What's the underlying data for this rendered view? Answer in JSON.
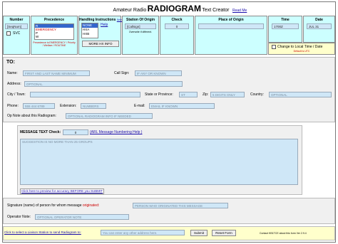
{
  "header": {
    "title_pre": "Amateur Radio",
    "title_main": "RADIOGRAM",
    "title_post": "Text Creator",
    "read_me": "Read Me"
  },
  "columns": {
    "number": {
      "label": "Number",
      "value": "[SeqNum]",
      "svc": "SVC"
    },
    "precedence": {
      "label": "Precedence",
      "options": [
        "R",
        "EMERGENCY",
        "P",
        "W"
      ],
      "note": "Precedence is EMERGENCY / Priority / Welfare / ROUTINE"
    },
    "handling": {
      "label": "Handling Instructions",
      "select_link": "Select",
      "help_link": "Help",
      "options": [
        "NONE",
        "HXA",
        "HXB"
      ],
      "more": "MORE HX INFO"
    },
    "station_origin": {
      "label": "Station Of Origin",
      "value": "[Callsign]",
      "note": "Overwrite if different."
    },
    "check": {
      "label": "Check",
      "value": "0"
    },
    "place_origin": {
      "label": "Place of Origin",
      "value": ""
    },
    "time": {
      "label": "Time",
      "value": "1700Z"
    },
    "date": {
      "label": "Date",
      "value": "JUL 31"
    },
    "local_time": {
      "label": "Change to Local Time / Date",
      "note": "Default is UTC"
    }
  },
  "to": {
    "heading": "TO:",
    "name_label": "Name:",
    "name_placeholder": "FIRST AND LAST NAME MINIMUM",
    "callsign_label": "Call Sign:",
    "callsign_placeholder": "IF ANY OR KNOWN",
    "address_label": "Address:",
    "address_placeholder": "OPTIONAL",
    "city_label": "City / Town:",
    "state_label": "State or Province:",
    "state_placeholder": "ST",
    "zip_label": "Zip:",
    "zip_placeholder": "5 DIGITS ONLY",
    "country_label": "Country:",
    "country_placeholder": "OPTIONAL",
    "phone_label": "Phone:",
    "phone_placeholder": "555 444 6789",
    "ext_label": "Extension:",
    "ext_placeholder": "NUMBERS",
    "email_label": "E-mail:",
    "email_placeholder": "EMAIL IF KNOWN",
    "opnote_label": "Op Note about this Radiogram:",
    "opnote_placeholder": "OPTIONAL RADIOGRAM INFO IF NEEDED"
  },
  "message": {
    "label": "MESSAGE TEXT Check:",
    "check_value": "0",
    "arl_link": "(ARL Message Numbering Help )",
    "placeholder": "SUGGESTION IS NO MORE THAN 25 GROUPS",
    "preview_link": "Click here to preview for accuracy BEFORE you SUBMIT"
  },
  "signature": {
    "label_pre": "Signature (name) of person for whom message",
    "label_red": "originated:",
    "placeholder": "PERSON WHO ORIGINATED THIS MESSAGE",
    "opnote_label": "Operator Note:",
    "opnote_placeholder": "OPTIONAL OPERATOR NOTE"
  },
  "footer": {
    "liaison_link": "Click to select a Liaison Station to send Radiogram to:",
    "email_placeholder": "You can enter any other address here.",
    "submit": "Submit",
    "reset": "Reset Form",
    "credit": "Contact KB1TCE about this form  Ver 2.9.4"
  },
  "colors": {
    "header_bg": "#ccffff",
    "input_bg": "#cfe7f7",
    "footer_bg": "#ffffcc",
    "accent_red": "#cc0000"
  }
}
